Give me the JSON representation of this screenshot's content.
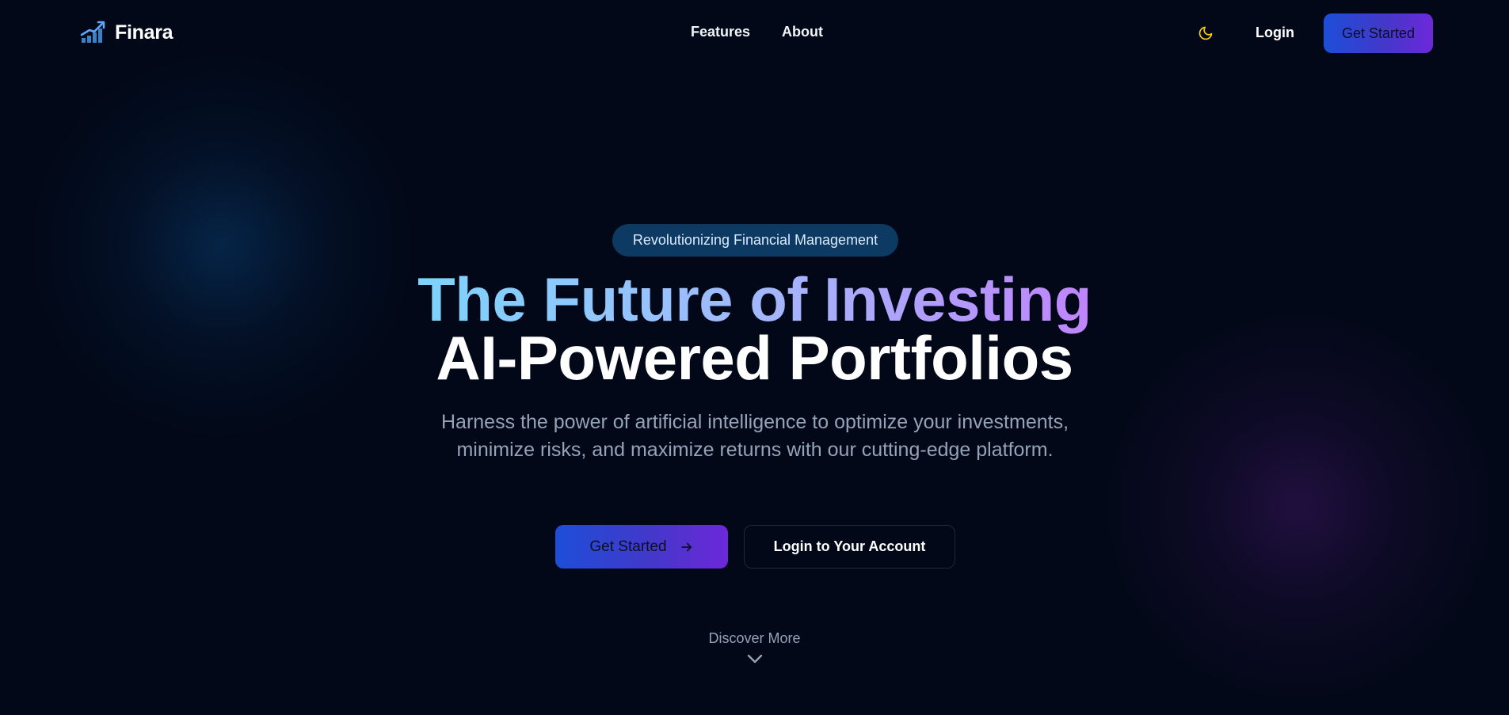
{
  "brand": {
    "name": "Finara",
    "logo_icon": "growth-chart-icon"
  },
  "nav": {
    "links": [
      {
        "label": "Features"
      },
      {
        "label": "About"
      }
    ],
    "theme_toggle_icon": "moon-icon",
    "login_label": "Login",
    "cta_label": "Get Started"
  },
  "hero": {
    "badge": "Revolutionizing Financial Management",
    "title_line1": "The Future of Investing",
    "title_line2": "AI-Powered Portfolios",
    "subtitle": "Harness the power of artificial intelligence to optimize your investments, minimize risks, and maximize returns with our cutting-edge platform.",
    "primary_button": "Get Started",
    "primary_button_icon": "arrow-right-icon",
    "secondary_button": "Login to Your Account",
    "discover_label": "Discover More",
    "discover_icon": "chevron-down-icon"
  },
  "colors": {
    "background": "#020817",
    "accent_gradient_start": "#1d4ed8",
    "accent_gradient_end": "#6d28d9",
    "badge_bg": "#0c3a63",
    "moon_icon": "#facc15",
    "muted_text": "#94a3b8"
  }
}
